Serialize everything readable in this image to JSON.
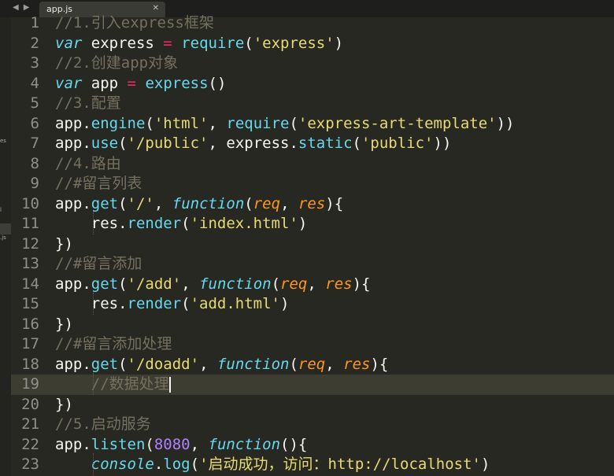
{
  "tabbar": {
    "nav_back": "◀",
    "nav_forward": "▶",
    "active_tab": "app.js",
    "close_glyph": "✕"
  },
  "sidebar": {
    "fragments": [
      "es",
      "l",
      ".js"
    ]
  },
  "editor": {
    "active_line": 19,
    "lines": [
      {
        "n": "1",
        "tokens": [
          {
            "t": "//1.引入express框架",
            "c": "com"
          }
        ]
      },
      {
        "n": "2",
        "tokens": [
          {
            "t": "var",
            "c": "kw"
          },
          {
            "t": " express ",
            "c": "txt"
          },
          {
            "t": "=",
            "c": "op"
          },
          {
            "t": " ",
            "c": "txt"
          },
          {
            "t": "require",
            "c": "fn"
          },
          {
            "t": "(",
            "c": "txt"
          },
          {
            "t": "'express'",
            "c": "str"
          },
          {
            "t": ")",
            "c": "txt"
          }
        ]
      },
      {
        "n": "3",
        "tokens": [
          {
            "t": "//2.创建app对象",
            "c": "com"
          }
        ]
      },
      {
        "n": "4",
        "tokens": [
          {
            "t": "var",
            "c": "kw"
          },
          {
            "t": " app ",
            "c": "txt"
          },
          {
            "t": "=",
            "c": "op"
          },
          {
            "t": " ",
            "c": "txt"
          },
          {
            "t": "express",
            "c": "fn"
          },
          {
            "t": "()",
            "c": "txt"
          }
        ]
      },
      {
        "n": "5",
        "tokens": [
          {
            "t": "//3.配置",
            "c": "com"
          }
        ]
      },
      {
        "n": "6",
        "tokens": [
          {
            "t": "app.",
            "c": "txt"
          },
          {
            "t": "engine",
            "c": "fn"
          },
          {
            "t": "(",
            "c": "txt"
          },
          {
            "t": "'html'",
            "c": "str"
          },
          {
            "t": ", ",
            "c": "txt"
          },
          {
            "t": "require",
            "c": "fn"
          },
          {
            "t": "(",
            "c": "txt"
          },
          {
            "t": "'express-art-template'",
            "c": "str"
          },
          {
            "t": "))",
            "c": "txt"
          }
        ]
      },
      {
        "n": "7",
        "tokens": [
          {
            "t": "app.",
            "c": "txt"
          },
          {
            "t": "use",
            "c": "fn"
          },
          {
            "t": "(",
            "c": "txt"
          },
          {
            "t": "'/public'",
            "c": "str"
          },
          {
            "t": ", express.",
            "c": "txt"
          },
          {
            "t": "static",
            "c": "fn"
          },
          {
            "t": "(",
            "c": "txt"
          },
          {
            "t": "'public'",
            "c": "str"
          },
          {
            "t": "))",
            "c": "txt"
          }
        ]
      },
      {
        "n": "8",
        "tokens": [
          {
            "t": "//4.路由",
            "c": "com"
          }
        ]
      },
      {
        "n": "9",
        "tokens": [
          {
            "t": "//#留言列表",
            "c": "com"
          }
        ]
      },
      {
        "n": "10",
        "tokens": [
          {
            "t": "app.",
            "c": "txt"
          },
          {
            "t": "get",
            "c": "fn"
          },
          {
            "t": "(",
            "c": "txt"
          },
          {
            "t": "'/'",
            "c": "str"
          },
          {
            "t": ", ",
            "c": "txt"
          },
          {
            "t": "function",
            "c": "kw"
          },
          {
            "t": "(",
            "c": "txt"
          },
          {
            "t": "req",
            "c": "par"
          },
          {
            "t": ", ",
            "c": "txt"
          },
          {
            "t": "res",
            "c": "par"
          },
          {
            "t": "){",
            "c": "txt"
          }
        ]
      },
      {
        "n": "11",
        "tokens": [
          {
            "t": "    res.",
            "c": "txt"
          },
          {
            "t": "render",
            "c": "fn"
          },
          {
            "t": "(",
            "c": "txt"
          },
          {
            "t": "'index.html'",
            "c": "str"
          },
          {
            "t": ")",
            "c": "txt"
          }
        ]
      },
      {
        "n": "12",
        "tokens": [
          {
            "t": "})",
            "c": "txt"
          }
        ]
      },
      {
        "n": "13",
        "tokens": [
          {
            "t": "//#留言添加",
            "c": "com"
          }
        ]
      },
      {
        "n": "14",
        "tokens": [
          {
            "t": "app.",
            "c": "txt"
          },
          {
            "t": "get",
            "c": "fn"
          },
          {
            "t": "(",
            "c": "txt"
          },
          {
            "t": "'/add'",
            "c": "str"
          },
          {
            "t": ", ",
            "c": "txt"
          },
          {
            "t": "function",
            "c": "kw"
          },
          {
            "t": "(",
            "c": "txt"
          },
          {
            "t": "req",
            "c": "par"
          },
          {
            "t": ", ",
            "c": "txt"
          },
          {
            "t": "res",
            "c": "par"
          },
          {
            "t": "){",
            "c": "txt"
          }
        ]
      },
      {
        "n": "15",
        "tokens": [
          {
            "t": "    res.",
            "c": "txt"
          },
          {
            "t": "render",
            "c": "fn"
          },
          {
            "t": "(",
            "c": "txt"
          },
          {
            "t": "'add.html'",
            "c": "str"
          },
          {
            "t": ")",
            "c": "txt"
          }
        ]
      },
      {
        "n": "16",
        "tokens": [
          {
            "t": "})",
            "c": "txt"
          }
        ]
      },
      {
        "n": "17",
        "tokens": [
          {
            "t": "//#留言添加处理",
            "c": "com"
          }
        ]
      },
      {
        "n": "18",
        "tokens": [
          {
            "t": "app.",
            "c": "txt"
          },
          {
            "t": "get",
            "c": "fn"
          },
          {
            "t": "(",
            "c": "txt"
          },
          {
            "t": "'/doadd'",
            "c": "str"
          },
          {
            "t": ", ",
            "c": "txt"
          },
          {
            "t": "function",
            "c": "kw"
          },
          {
            "t": "(",
            "c": "txt"
          },
          {
            "t": "req",
            "c": "par"
          },
          {
            "t": ", ",
            "c": "txt"
          },
          {
            "t": "res",
            "c": "par"
          },
          {
            "t": "){",
            "c": "txt"
          }
        ]
      },
      {
        "n": "19",
        "tokens": [
          {
            "t": "    //数据处理",
            "c": "com"
          }
        ]
      },
      {
        "n": "20",
        "tokens": [
          {
            "t": "})",
            "c": "txt"
          }
        ]
      },
      {
        "n": "21",
        "tokens": [
          {
            "t": "//5.启动服务",
            "c": "com"
          }
        ]
      },
      {
        "n": "22",
        "tokens": [
          {
            "t": "app.",
            "c": "txt"
          },
          {
            "t": "listen",
            "c": "fn"
          },
          {
            "t": "(",
            "c": "txt"
          },
          {
            "t": "8080",
            "c": "num"
          },
          {
            "t": ", ",
            "c": "txt"
          },
          {
            "t": "function",
            "c": "kw"
          },
          {
            "t": "(){",
            "c": "txt"
          }
        ]
      },
      {
        "n": "23",
        "tokens": [
          {
            "t": "    ",
            "c": "txt"
          },
          {
            "t": "console",
            "c": "sup"
          },
          {
            "t": ".",
            "c": "txt"
          },
          {
            "t": "log",
            "c": "fn"
          },
          {
            "t": "(",
            "c": "txt"
          },
          {
            "t": "'启动成功，访问：http://localhost'",
            "c": "str"
          },
          {
            "t": ")",
            "c": "txt"
          }
        ]
      }
    ]
  },
  "colors": {
    "background": "#272822",
    "comment": "#75715e",
    "keyword": "#66d9ef",
    "string": "#e6db74",
    "operator": "#f92672",
    "parameter": "#fd971f",
    "number": "#ae81ff"
  }
}
